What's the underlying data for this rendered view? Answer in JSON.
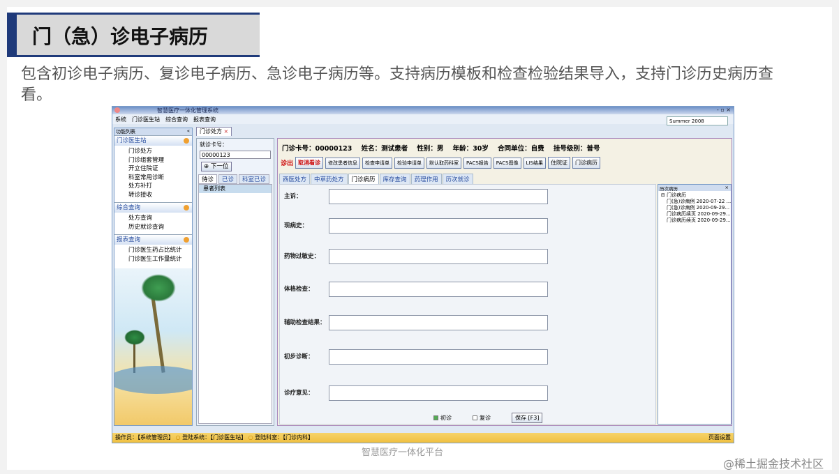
{
  "slide": {
    "title": "门（急）诊电子病历",
    "description": "包含初诊电子病历、复诊电子病历、急诊电子病历等。支持病历模板和检查检验结果导入，支持门诊历史病历查看。",
    "footer": "智慧医疗一体化平台",
    "watermark": "@稀土掘金技术社区"
  },
  "app": {
    "title": "智慧医疗一体化管理系统",
    "window_controls": "- ▫ ×",
    "menu": [
      "系统",
      "门诊医生站",
      "综合查询",
      "报表查询"
    ],
    "theme": "Summer 2008",
    "doc_tab": "门诊处方",
    "doc_tab_close": "×"
  },
  "sidebar": {
    "header": "功能列表",
    "header_btn": "«",
    "groups": [
      {
        "title": "门诊医生站",
        "items": [
          "门诊处方",
          "门诊组套管理",
          "开立住院证",
          "科室常用诊断",
          "处方补打",
          "转诊接收"
        ]
      },
      {
        "title": "综合查询",
        "items": [
          "处方查询",
          "历史就诊查询"
        ]
      },
      {
        "title": "报表查询",
        "items": [
          "门诊医生药占比统计",
          "门诊医生工作量统计"
        ]
      }
    ]
  },
  "queue": {
    "card_label": "就诊卡号：",
    "card_value": "00000123",
    "next_button": "下一位",
    "tabs": [
      "待诊",
      "已诊",
      "科室已诊"
    ],
    "list_header": "患者列表"
  },
  "patient": {
    "card_no_label": "门诊卡号：",
    "card_no": "00000123",
    "name_label": "姓名：",
    "name": "测试患者",
    "sex_label": "性别：",
    "sex": "男",
    "age_label": "年龄：",
    "age": "30岁",
    "contract_label": "合同单位：",
    "contract": "自费",
    "reg_label": "挂号级别：",
    "reg": "普号"
  },
  "actions": {
    "checkout": "诊出",
    "cancel": "取消看诊",
    "buttons": [
      "修改患者信息",
      "检查申请单",
      "检验申请单",
      "默认取药科室",
      "PACS报告",
      "PACS图像",
      "LIS结果"
    ],
    "big_buttons": [
      "住院证",
      "门诊病历"
    ]
  },
  "subtabs": [
    "西医处方",
    "中草药处方",
    "门诊病历",
    "库存查询",
    "药理作用",
    "历次就诊"
  ],
  "form": {
    "fields": [
      {
        "label": "主诉：",
        "value": ""
      },
      {
        "label": "现病史：",
        "value": ""
      },
      {
        "label": "药物过敏史：",
        "value": ""
      },
      {
        "label": "体格检查：",
        "value": ""
      },
      {
        "label": "辅助检查结果：",
        "value": ""
      },
      {
        "label": "初步诊断：",
        "value": ""
      },
      {
        "label": "诊疗意见：",
        "value": ""
      }
    ],
    "first_visit": "初诊",
    "return_visit": "复诊",
    "save": "保存 [F3]"
  },
  "history": {
    "header": "历次病历",
    "close": "×",
    "root": "门诊病历",
    "items": [
      "门(急)诊病例 2020-07-22 ...",
      "门(急)诊病例 2020-09-29...",
      "门诊病历续页 2020-09-29...",
      "门诊病历续页 2020-09-29..."
    ]
  },
  "status": {
    "operator": "操作员：【系统管理员】",
    "system": "登陆系统：【门诊医生站】",
    "dept": "登陆科室：【门诊内科】",
    "page_setup": "页面设置"
  }
}
